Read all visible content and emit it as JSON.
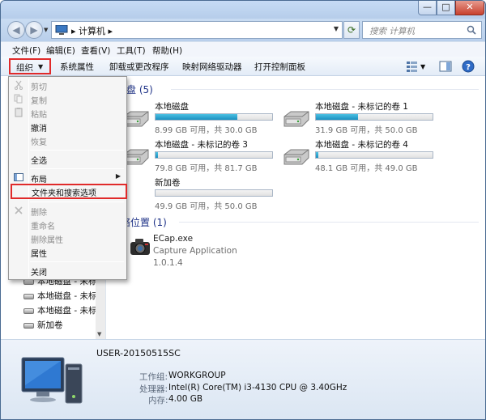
{
  "titlebar": {
    "minimize": "—",
    "maximize": "□",
    "close": "✕"
  },
  "address": {
    "location": "计算机",
    "separator": "▸",
    "search_placeholder": "搜索 计算机"
  },
  "menubar": [
    "文件(F)",
    "编辑(E)",
    "查看(V)",
    "工具(T)",
    "帮助(H)"
  ],
  "toolbar": {
    "organize": "组织",
    "items": [
      "系统属性",
      "卸载或更改程序",
      "映射网络驱动器",
      "打开控制面板"
    ]
  },
  "dropdown": {
    "items": [
      {
        "label": "剪切",
        "disabled": true
      },
      {
        "label": "复制",
        "disabled": true
      },
      {
        "label": "粘贴",
        "disabled": true
      },
      {
        "label": "撤消",
        "disabled": false
      },
      {
        "label": "恢复",
        "disabled": true
      },
      {
        "label": "全选",
        "disabled": false
      },
      {
        "label": "布局",
        "disabled": false
      },
      {
        "label": "文件夹和搜索选项",
        "disabled": false
      },
      {
        "label": "删除",
        "disabled": true
      },
      {
        "label": "重命名",
        "disabled": true
      },
      {
        "label": "删除属性",
        "disabled": true
      },
      {
        "label": "属性",
        "disabled": false
      },
      {
        "label": "关闭",
        "disabled": false
      }
    ]
  },
  "navtree": [
    "本地磁盘 - 未标",
    "本地磁盘 - 未标",
    "本地磁盘 - 未标",
    "新加卷"
  ],
  "sections": {
    "hdd": "盘 (5)",
    "other": "络位置 (1)"
  },
  "drives": [
    {
      "name": "本地磁盘",
      "info": "8.99 GB 可用，共 30.0 GB",
      "used": 0.7
    },
    {
      "name": "本地磁盘 - 未标记的卷 1",
      "info": "31.9 GB 可用，共 50.0 GB",
      "used": 0.36
    },
    {
      "name": "本地磁盘 - 未标记的卷 3",
      "info": "79.8 GB 可用，共 81.7 GB",
      "used": 0.02
    },
    {
      "name": "本地磁盘 - 未标记的卷 4",
      "info": "48.1 GB 可用，共 49.0 GB",
      "used": 0.02
    },
    {
      "name": "新加卷",
      "info": "49.9 GB 可用，共 50.0 GB",
      "used": 0.0
    }
  ],
  "app": {
    "name": "ECap.exe",
    "desc": "Capture Application",
    "version": "1.0.1.4"
  },
  "details": {
    "computer": "USER-20150515SC",
    "workgroup_label": "工作组:",
    "workgroup": "WORKGROUP",
    "cpu_label": "处理器:",
    "cpu": "Intel(R) Core(TM) i3-4130 CPU @ 3.40GHz",
    "mem_label": "内存:",
    "mem": "4.00 GB"
  },
  "colors": {
    "highlight_box": "#e02a2a",
    "bar_fill": "#1a8fc0"
  }
}
